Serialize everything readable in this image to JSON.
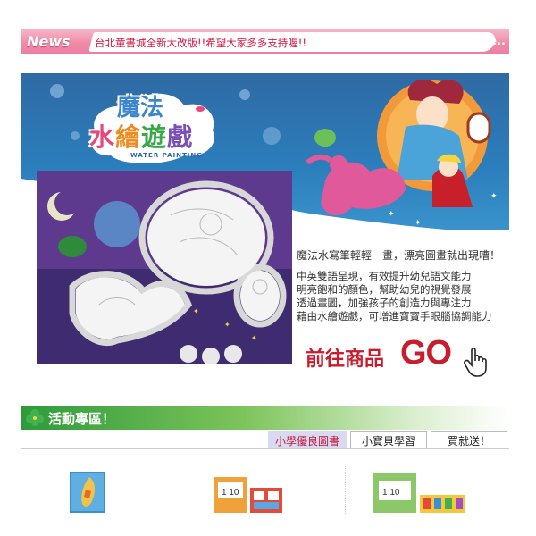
{
  "news": {
    "label": "News",
    "headline": "台北童書城全新大改版!!希望大家多多支持喔!!",
    "more": "More.."
  },
  "banner": {
    "logo_line1": "魔法",
    "logo_line2": "水繪遊戲",
    "logo_sub": "WATER PAINTING",
    "description_head": "魔法水寫筆輕輕一畫，漂亮圖畫就出現嘈！",
    "description_lines": [
      "中英雙語呈現，有效提升幼兒語文能力",
      "明亮飽和的顏色，幫助幼兒的視覺發展",
      "透過畫圖，加強孩子的創造力與專注力",
      "藉由水繪遊戲，可增進寶寶手眼腦協調能力"
    ],
    "go_label": "前往商品",
    "go_big": "GO"
  },
  "events": {
    "title": "活動專區！",
    "tabs": [
      "小學優良圖書",
      "小寶貝學習",
      "買就送！"
    ],
    "active_tab": 0
  },
  "products": [
    {
      "name": "taiwan-map-puzzle"
    },
    {
      "name": "number-cards-set"
    },
    {
      "name": "number-learning-kit"
    }
  ],
  "colors": {
    "news_pink": "#f08aa8",
    "news_text": "#d6163f",
    "go_red": "#c81d2c",
    "events_green": "#2f9a3b",
    "active_tab_bg": "#d9d9f0"
  }
}
